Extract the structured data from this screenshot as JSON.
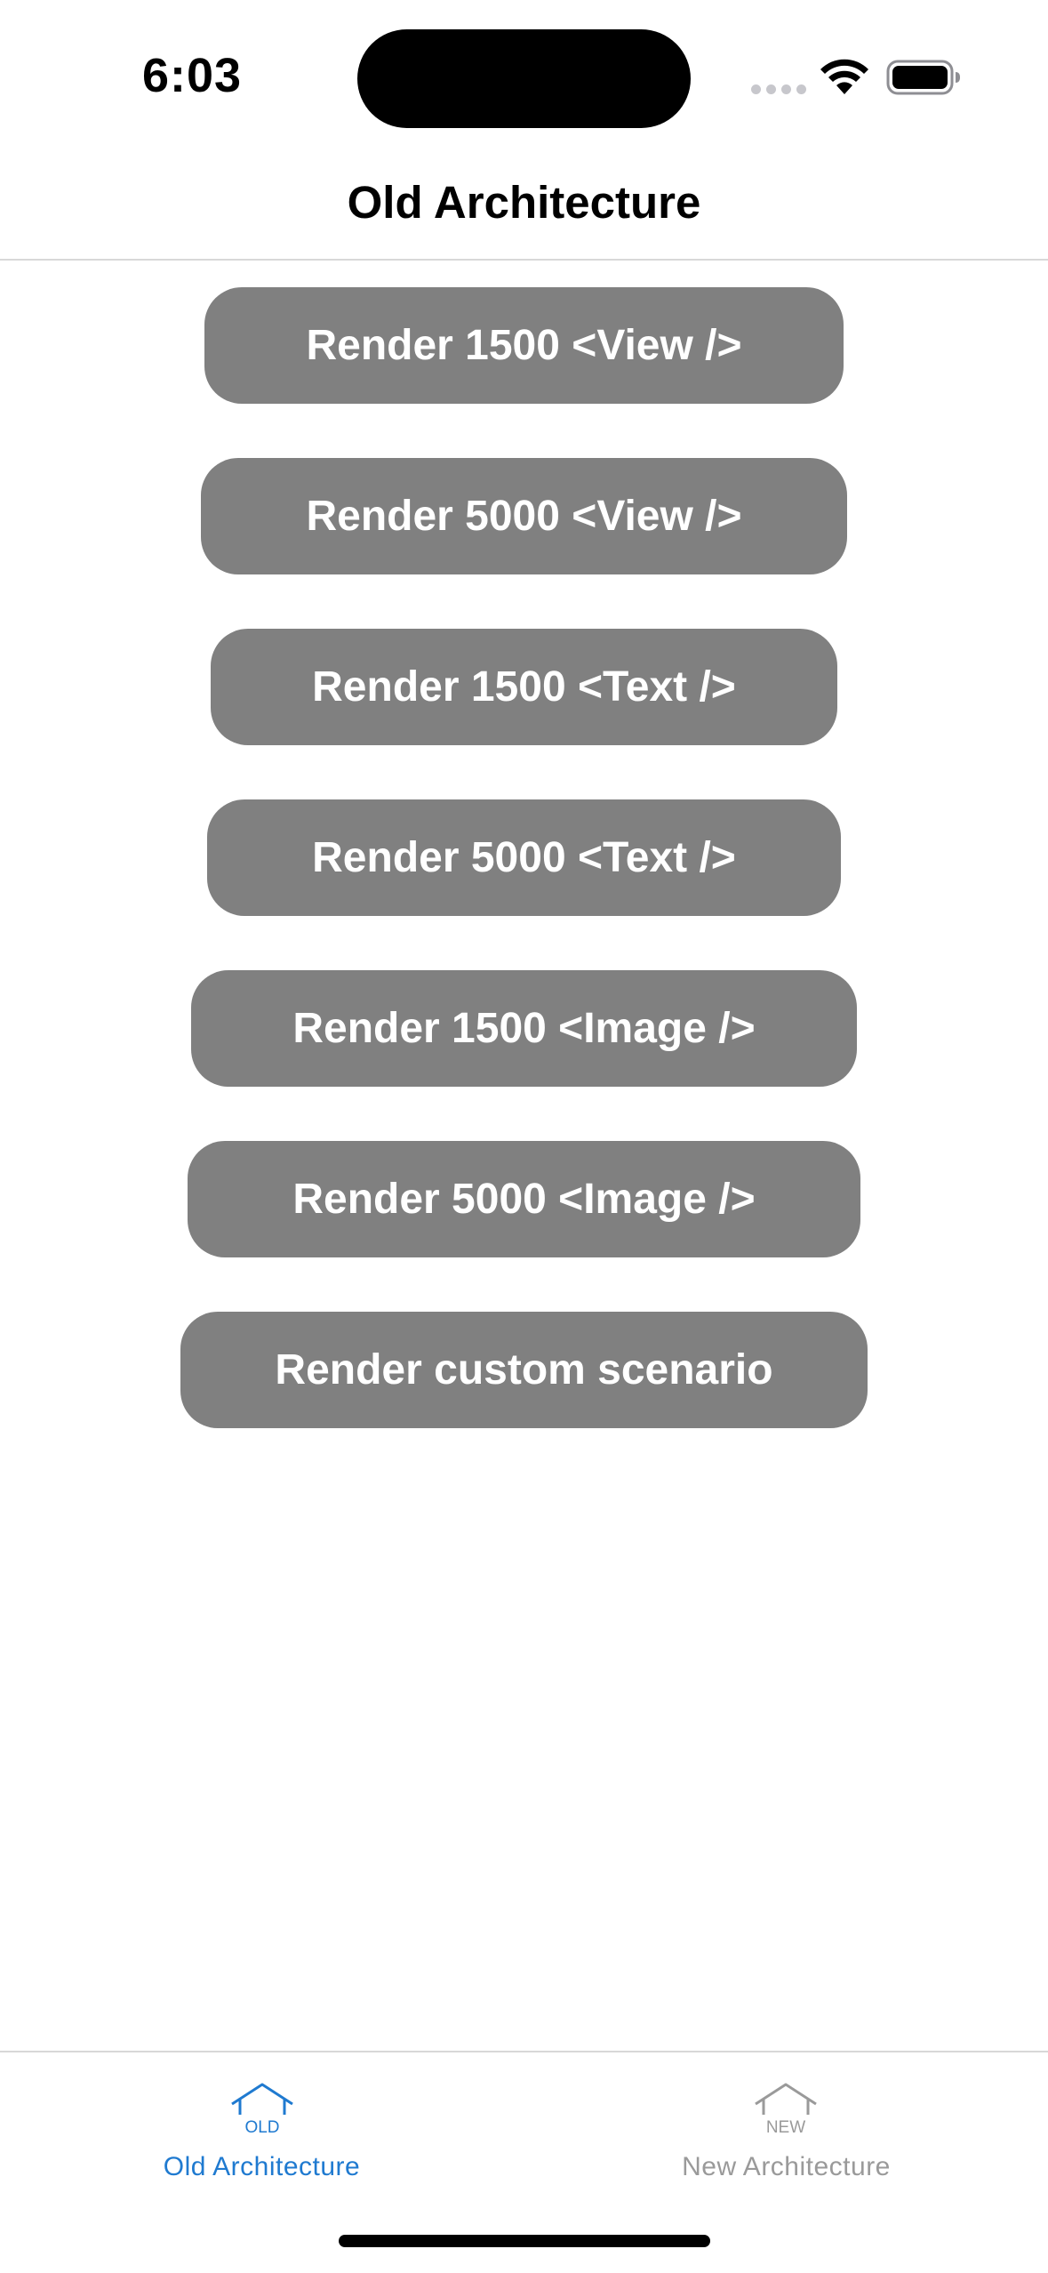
{
  "status_bar": {
    "time": "6:03"
  },
  "header": {
    "title": "Old Architecture"
  },
  "buttons": [
    {
      "label": "Render 1500 <View />"
    },
    {
      "label": "Render 5000 <View />"
    },
    {
      "label": "Render 1500 <Text />"
    },
    {
      "label": "Render 5000 <Text />"
    },
    {
      "label": "Render 1500 <Image />"
    },
    {
      "label": "Render 5000 <Image />"
    },
    {
      "label": "Render custom scenario"
    }
  ],
  "tabs": [
    {
      "label": "Old Architecture",
      "icon_text": "OLD",
      "icon": "house-icon",
      "active": true
    },
    {
      "label": "New Architecture",
      "icon_text": "NEW",
      "icon": "house-icon",
      "active": false
    }
  ],
  "colors": {
    "button_bg": "#808080",
    "active_tab": "#1f7ad0",
    "inactive_tab": "#9a9a9a"
  }
}
